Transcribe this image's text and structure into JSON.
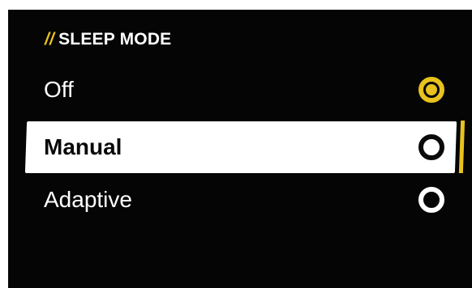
{
  "section": {
    "prefix": "//",
    "title": "SLEEP MODE"
  },
  "options": [
    {
      "label": "Off",
      "state": "selected"
    },
    {
      "label": "Manual",
      "state": "focused"
    },
    {
      "label": "Adaptive",
      "state": "unselected"
    }
  ],
  "colors": {
    "background": "#050505",
    "accent": "#e8c21d",
    "text": "#ffffff",
    "focus_background": "#ffffff",
    "focus_text": "#0a0a0a"
  },
  "icons": {
    "radio_selected": "radio-selected-icon",
    "radio_unselected": "radio-unselected-icon"
  }
}
